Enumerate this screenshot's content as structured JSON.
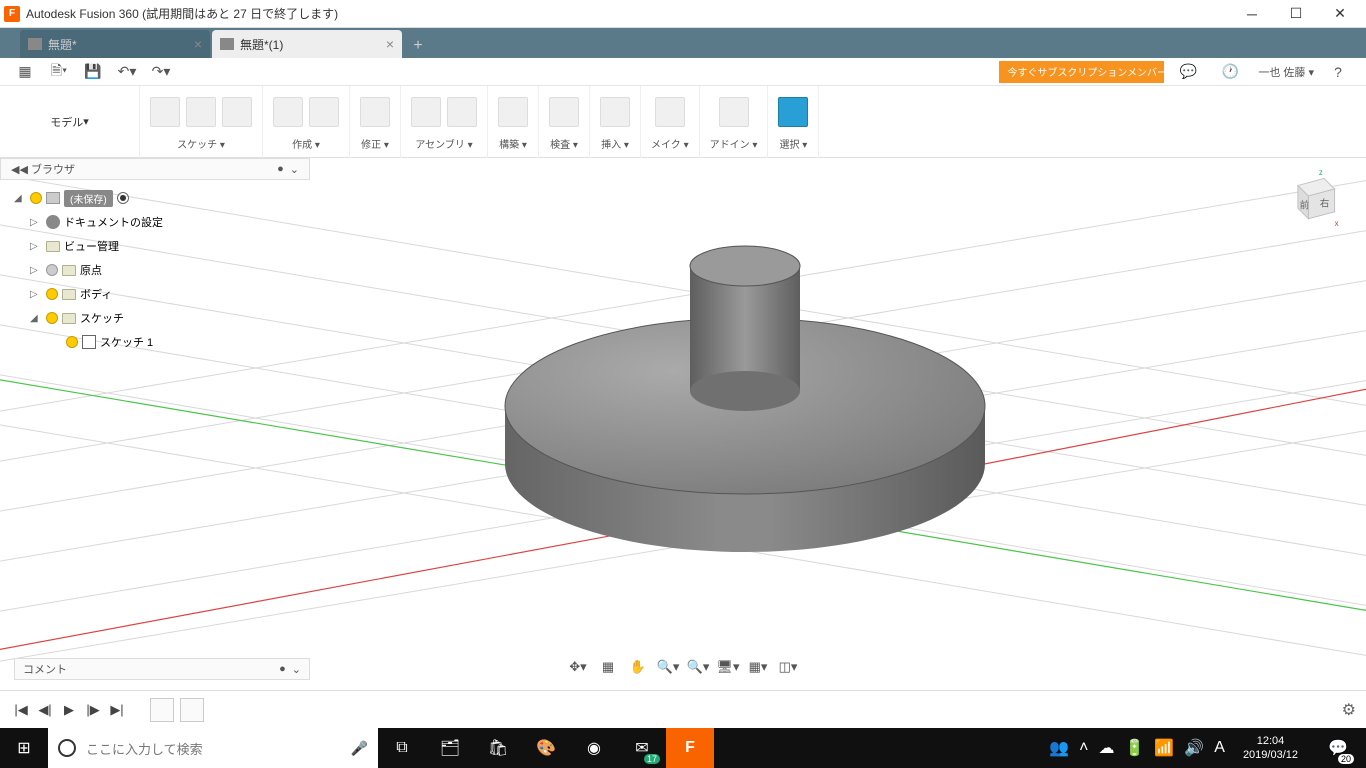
{
  "titlebar": {
    "app_icon": "F",
    "title": "Autodesk Fusion 360 (試用期間はあと 27 日で終了します)"
  },
  "tabs": {
    "inactive": "無題*",
    "active": "無題*(1)"
  },
  "qat": {
    "subscribe": "今すぐサブスクリプションメンバーに...",
    "user": "一也 佐藤"
  },
  "ribbon": {
    "mode": "モデル",
    "groups": {
      "sketch": "スケッチ",
      "create": "作成",
      "modify": "修正",
      "assembly": "アセンブリ",
      "construct": "構築",
      "inspect": "検査",
      "insert": "挿入",
      "make": "メイク",
      "addins": "アドイン",
      "select": "選択"
    }
  },
  "browser": {
    "title": "ブラウザ",
    "root": "(未保存)",
    "doc_settings": "ドキュメントの設定",
    "view_mgmt": "ビュー管理",
    "origin": "原点",
    "bodies": "ボディ",
    "sketches": "スケッチ",
    "sketch1": "スケッチ 1"
  },
  "viewcube": {
    "front": "前",
    "right": "右",
    "z": "z",
    "x": "x"
  },
  "comments": {
    "label": "コメント"
  },
  "taskbar": {
    "search_placeholder": "ここに入力して検索",
    "time": "12:04",
    "date": "2019/03/12",
    "mail_badge": "17",
    "notif_count": "20"
  }
}
